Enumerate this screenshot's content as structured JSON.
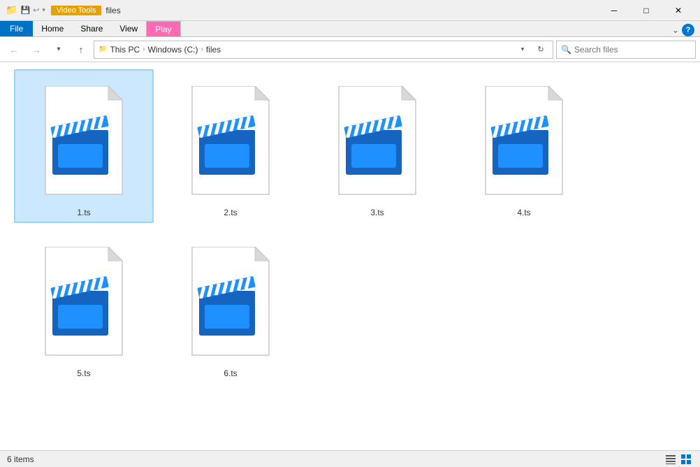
{
  "titlebar": {
    "title": "files",
    "video_tools_label": "Video Tools",
    "min_label": "─",
    "max_label": "□",
    "close_label": "✕"
  },
  "ribbon": {
    "tabs": [
      "File",
      "Home",
      "Share",
      "View",
      "Play"
    ],
    "active_tab": "Play"
  },
  "addressbar": {
    "back_label": "←",
    "forward_label": "→",
    "up_label": "↑",
    "path": [
      "This PC",
      "Windows (C:)",
      "files"
    ],
    "refresh_label": "↻",
    "search_placeholder": "Search files"
  },
  "files": [
    {
      "name": "1.ts",
      "selected": true
    },
    {
      "name": "2.ts",
      "selected": false
    },
    {
      "name": "3.ts",
      "selected": false
    },
    {
      "name": "4.ts",
      "selected": false
    },
    {
      "name": "5.ts",
      "selected": false
    },
    {
      "name": "6.ts",
      "selected": false
    }
  ],
  "statusbar": {
    "item_count": "6 items"
  },
  "colors": {
    "accent_blue": "#0078d4",
    "clapperboard_blue": "#1e90ff",
    "clapperboard_dark": "#1565c0"
  }
}
